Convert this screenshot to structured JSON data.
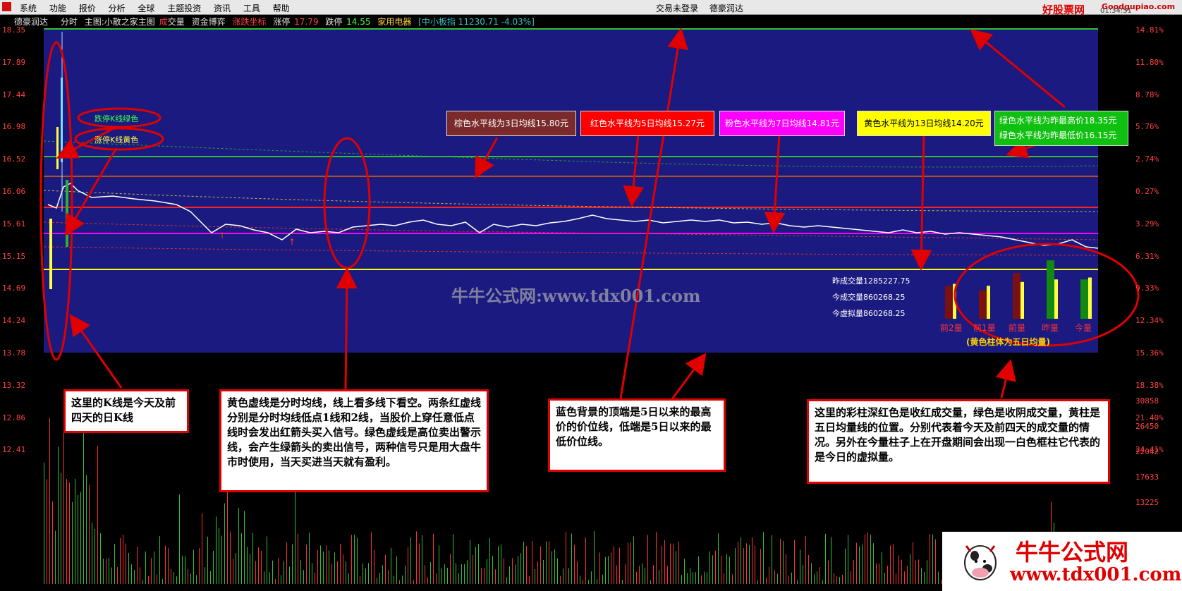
{
  "menubar": {
    "items": [
      "系统",
      "功能",
      "报价",
      "分析",
      "全球",
      "主题投资",
      "资讯",
      "工具",
      "帮助"
    ],
    "status": [
      "交易未登录",
      "德豪润达"
    ],
    "brand": "好股票网",
    "brand_url": "Goodgupiao.com",
    "right_text": "股票软件公式",
    "time": "01:34:51"
  },
  "titlebar": {
    "stock": "德豪润达",
    "tab": "分时",
    "main_chart": "主图:小散之家主图",
    "volume_a": "成",
    "volume_b": "交量",
    "fund": "资金博弈",
    "limit_coords": "涨跌坐标",
    "limit_up_label": "涨停",
    "limit_up_value": "17.79",
    "limit_down_label": "跌停",
    "limit_down_value": "14.55",
    "sector": "家用电器",
    "index": "[中小板指 11230.71 -4.03%]"
  },
  "price_axis_left": [
    "18.35",
    "17.89",
    "17.44",
    "16.98",
    "16.52",
    "16.06",
    "15.61",
    "15.15",
    "14.69",
    "14.24",
    "13.78",
    "13.32",
    "12.86",
    "12.41"
  ],
  "price_axis_right": [
    "14.81%",
    "11.80%",
    "8.78%",
    "5.76%",
    "2.74%",
    "0.27%",
    "3.29%",
    "6.31%",
    "9.33%",
    "12.34%",
    "15.36%",
    "18.38%",
    "21.40%",
    "24.41%"
  ],
  "volume_axis_right": [
    "30858",
    "26450",
    "22042",
    "17633",
    "13225"
  ],
  "info_boxes": [
    {
      "text": "棕色水平线为3日均线15.80元",
      "bg": "#7a2a2a",
      "color": "#ffffff"
    },
    {
      "text": "红色水平线为5日均线15.27元",
      "bg": "#ff0000",
      "color": "#ffffff"
    },
    {
      "text": "粉色水平线为7日均线14.81元",
      "bg": "#ff00ff",
      "color": "#ffffff"
    },
    {
      "text": "黄色水平线为13日均线14.20元",
      "bg": "#ffff00",
      "color": "#000000"
    }
  ],
  "green_box": {
    "line1": "绿色水平线为昨最高价18.35元",
    "line2": "绿色水平线为昨最低价16.15元"
  },
  "kline_tags": {
    "green": "跌停K线绿色",
    "yellow": "涨停K线黄色"
  },
  "volume_info": {
    "prev": "昨成交量1285227.75",
    "today": "今成交量860268.25",
    "virtual": "今虚拟量860268.25"
  },
  "bar_labels": [
    "前2量",
    "前1量",
    "前量",
    "昨量",
    "今量"
  ],
  "bar_caption": "(黄色柱体为五日均量)",
  "bar_values": {
    "volume": [
      0.52,
      0.45,
      0.72,
      0.92,
      0.62
    ],
    "average": [
      0.55,
      0.52,
      0.58,
      0.62,
      0.65
    ],
    "colors": [
      "#7a1010",
      "#7a1010",
      "#7a1010",
      "#108a10",
      "#108a10"
    ]
  },
  "watermark": "牛牛公式网:www.tdx001.com",
  "notes": {
    "kline": "这里的K线是今天及前四天的日K线",
    "avgline": "黄色虚线是分时均线，线上看多线下看空。两条红虚线分别是分时均线低点1线和2线，当股价上穿任意低点线时会发出红箭头买入信号。绿色虚线是高位卖出警示线，会产生绿箭头的卖出信号，两种信号只是用大盘牛市时使用，当天买进当天就有盈利。",
    "bluebg": "蓝色背景的顶端是5日以来的最高价的价位线，低端是5日以来的最低价位线。",
    "bars": "这里的彩柱深红色是收红成交量，绿色是收阴成交量，黄柱是五日均量线的位置。分别代表着今天及前四天的成交量的情况。另外在今量柱子上在开盘期间会出现一白色框柱它代表的是今日的虚拟量。"
  },
  "promo": {
    "title": "牛牛公式网",
    "url": "www.tdx001.com"
  },
  "colors": {
    "chart_bg": "#1a1a80",
    "arrow": "#e00000"
  }
}
